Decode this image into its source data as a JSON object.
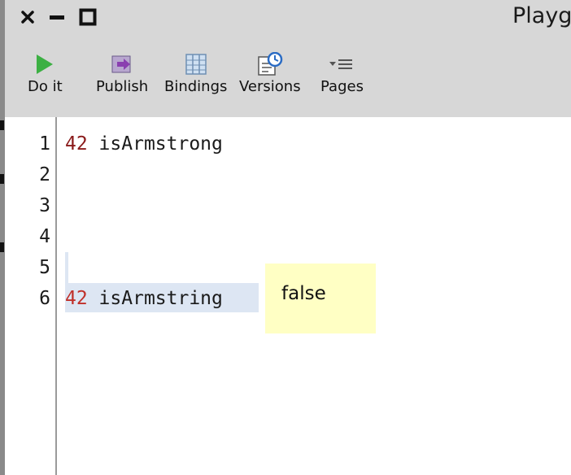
{
  "window": {
    "title": "Playg",
    "controls": [
      "close-icon",
      "minimize-icon",
      "maximize-icon"
    ]
  },
  "toolbar": {
    "items": [
      {
        "label": "Do it",
        "icon": "play-icon"
      },
      {
        "label": "Publish",
        "icon": "publish-icon"
      },
      {
        "label": "Bindings",
        "icon": "bindings-icon"
      },
      {
        "label": "Versions",
        "icon": "versions-icon"
      },
      {
        "label": "Pages",
        "icon": "pages-menu-icon"
      }
    ]
  },
  "editor": {
    "lines": [
      {
        "number": "1",
        "literal": "42",
        "message": " isArmstrong"
      },
      {
        "number": "2",
        "literal": "",
        "message": ""
      },
      {
        "number": "3",
        "literal": "",
        "message": ""
      },
      {
        "number": "4",
        "literal": "",
        "message": ""
      },
      {
        "number": "5",
        "literal": "",
        "message": ""
      },
      {
        "number": "6",
        "literal": "42",
        "message": " isArmstring"
      }
    ]
  },
  "result_popup": {
    "value": "false"
  },
  "colors": {
    "toolbar_bg": "#d7d7d7",
    "number_literal": "#8a1a1a",
    "selection": "#dde6f3",
    "popup_bg": "#ffffc4",
    "play_green": "#3cb043"
  }
}
